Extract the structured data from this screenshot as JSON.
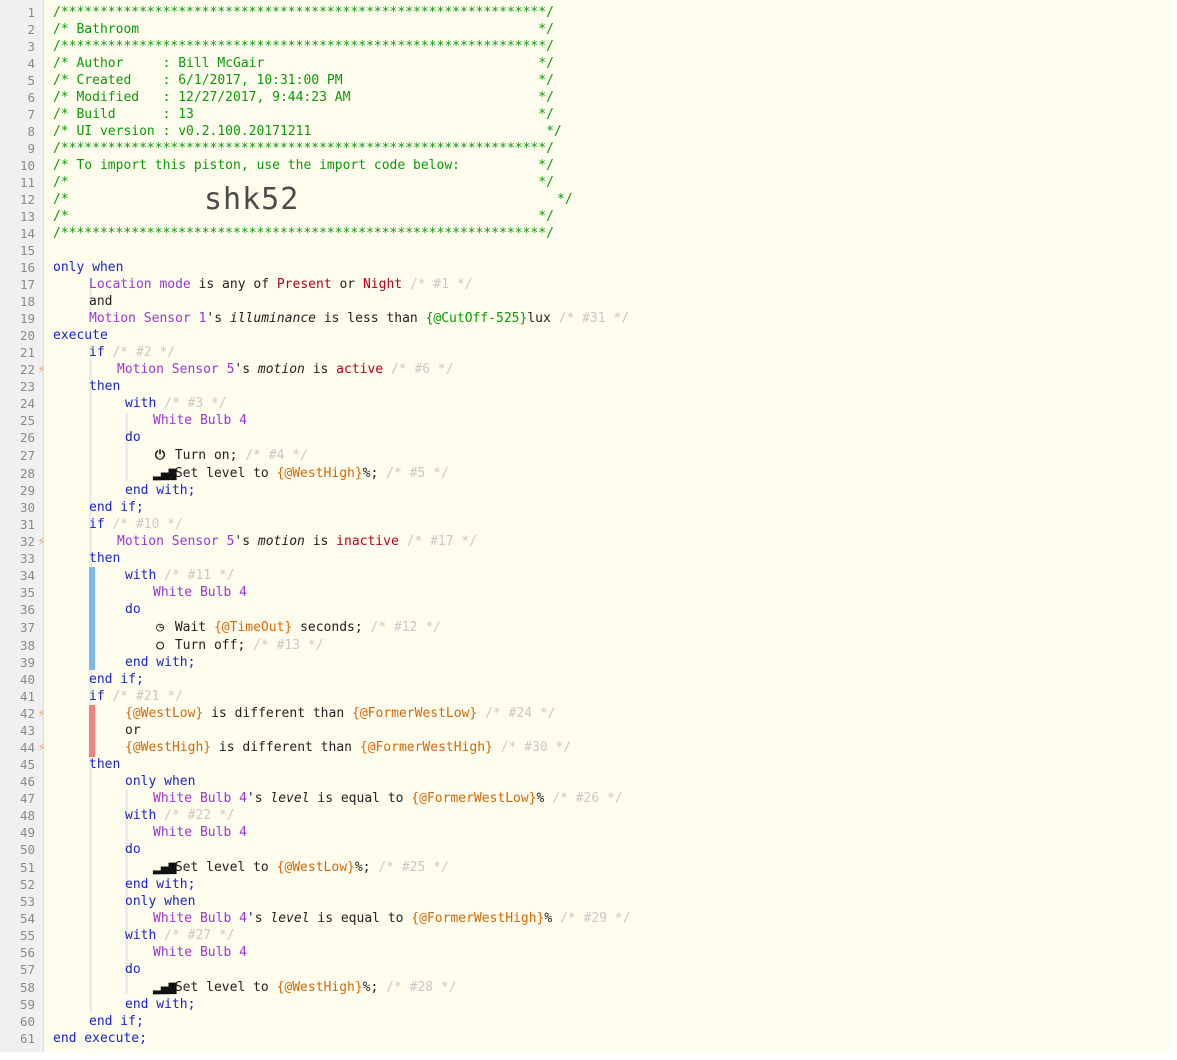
{
  "header": {
    "border": "/**************************************************************/",
    "title_line": "/* Bathroom                                                   */",
    "author_line": "/* Author     : Bill McGair                                   */",
    "created_line": "/* Created    : 6/1/2017, 10:31:00 PM                         */",
    "modified_line": "/* Modified   : 12/27/2017, 9:44:23 AM                        */",
    "build_line": "/* Build      : 13                                            */",
    "ui_line": "/* UI version : v0.2.100.20171211                              */",
    "import_line": "/* To import this piston, use the import code below:          */",
    "blank_line": "/*                                                            */",
    "code_prefix": "/*",
    "code_suffix": "*/",
    "import_code": "shk52"
  },
  "line_numbers": [
    "1",
    "2",
    "3",
    "4",
    "5",
    "6",
    "7",
    "8",
    "9",
    "10",
    "11",
    "12",
    "13",
    "14",
    "15",
    "16",
    "17",
    "18",
    "19",
    "20",
    "21",
    "22",
    "23",
    "24",
    "25",
    "26",
    "27",
    "28",
    "29",
    "30",
    "31",
    "32",
    "33",
    "34",
    "35",
    "36",
    "37",
    "38",
    "39",
    "40",
    "41",
    "42",
    "43",
    "44",
    "45",
    "46",
    "47",
    "48",
    "49",
    "50",
    "51",
    "52",
    "53",
    "54",
    "55",
    "56",
    "57",
    "58",
    "59",
    "60",
    "61"
  ],
  "trigger_icon": "⚡",
  "code": {
    "only_when": "only when",
    "location_mode": "Location mode",
    "is_any_of": "is any of",
    "present": "Present",
    "or": "or",
    "night": "Night",
    "id_1": "/* #1 */",
    "and": "and",
    "motion_sensor_1": "Motion Sensor 1",
    "possessive": "'s",
    "illuminance": "illuminance",
    "is_less_than": "is less than",
    "cutoff_expr": "{@CutOff-525}",
    "lux": "lux",
    "id_31": "/* #31 */",
    "execute": "execute",
    "if": "if",
    "id_2": "/* #2 */",
    "motion_sensor_5": "Motion Sensor 5",
    "motion": "motion",
    "is": "is",
    "active": "active",
    "id_6": "/* #6 */",
    "then": "then",
    "with": "with",
    "id_3": "/* #3 */",
    "white_bulb_4": "White Bulb 4",
    "do": "do",
    "turn_on": "Turn on;",
    "id_4": "/* #4 */",
    "set_level_to": "Set level to",
    "westhigh": "{@WestHigh}",
    "pct_semi": "%;",
    "id_5": "/* #5 */",
    "end_with": "end with;",
    "end_if": "end if;",
    "id_10": "/* #10 */",
    "inactive": "inactive",
    "id_17": "/* #17 */",
    "id_11": "/* #11 */",
    "wait": "Wait",
    "timeout": "{@TimeOut}",
    "seconds": "seconds;",
    "id_12": "/* #12 */",
    "turn_off": "Turn off;",
    "id_13": "/* #13 */",
    "id_21": "/* #21 */",
    "westlow": "{@WestLow}",
    "is_different_than": "is different than",
    "formerwestlow": "{@FormerWestLow}",
    "id_24": "/* #24 */",
    "formerwesthigh": "{@FormerWestHigh}",
    "id_30": "/* #30 */",
    "level": "level",
    "is_equal_to": "is equal to",
    "pct": "%",
    "id_26": "/* #26 */",
    "id_22": "/* #22 */",
    "id_25": "/* #25 */",
    "id_29": "/* #29 */",
    "id_27": "/* #27 */",
    "id_28": "/* #28 */",
    "end_execute": "end execute;"
  },
  "icons": {
    "power": "power-icon",
    "level": "signal-bars-icon",
    "wait": "clock-icon",
    "off": "circle-icon"
  },
  "colors": {
    "comment": "#0a9a0a",
    "keyword": "#1a24c9",
    "device": "#9b37d6",
    "value": "#b5001c",
    "variable": "#d5680b",
    "statement_id": "#c8c8c8",
    "bar_blue": "#7bb8ee",
    "bar_red": "#f47f7f",
    "trigger": "#f29a5b"
  }
}
